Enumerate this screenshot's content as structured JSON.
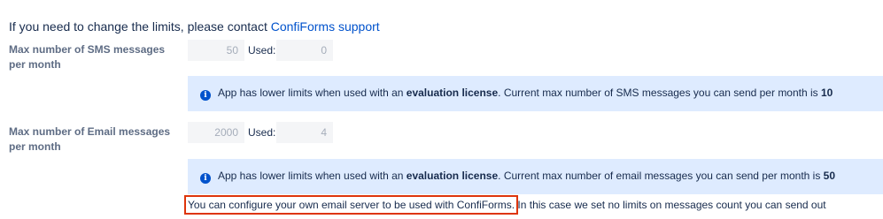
{
  "heading": {
    "prefix": "If you need to change the limits, please contact ",
    "link": "ConfiForms support"
  },
  "sms": {
    "label": "Max number of SMS messages per month",
    "max_value": "50",
    "used_label": "Used:",
    "used_value": "0",
    "info": {
      "prefix": "App has lower limits when used with an ",
      "bold": "evaluation license",
      "middle": ". Current max number of SMS messages you can send per month is ",
      "limit": "10"
    }
  },
  "email": {
    "label": "Max number of Email messages per month",
    "max_value": "2000",
    "used_label": "Used:",
    "used_value": "4",
    "info": {
      "prefix": "App has lower limits when used with an ",
      "bold": "evaluation license",
      "middle": ". Current max number of email messages you can send per month is ",
      "limit": "50"
    }
  },
  "note": {
    "highlighted": "You can configure your own email server to be used with ConfiForms.",
    "rest": " In this case we set no limits on messages count you can send out"
  },
  "icons": {
    "info": "i"
  },
  "colors": {
    "link": "#0052cc",
    "info_bg": "#deebff",
    "highlight_border": "#de350b"
  }
}
